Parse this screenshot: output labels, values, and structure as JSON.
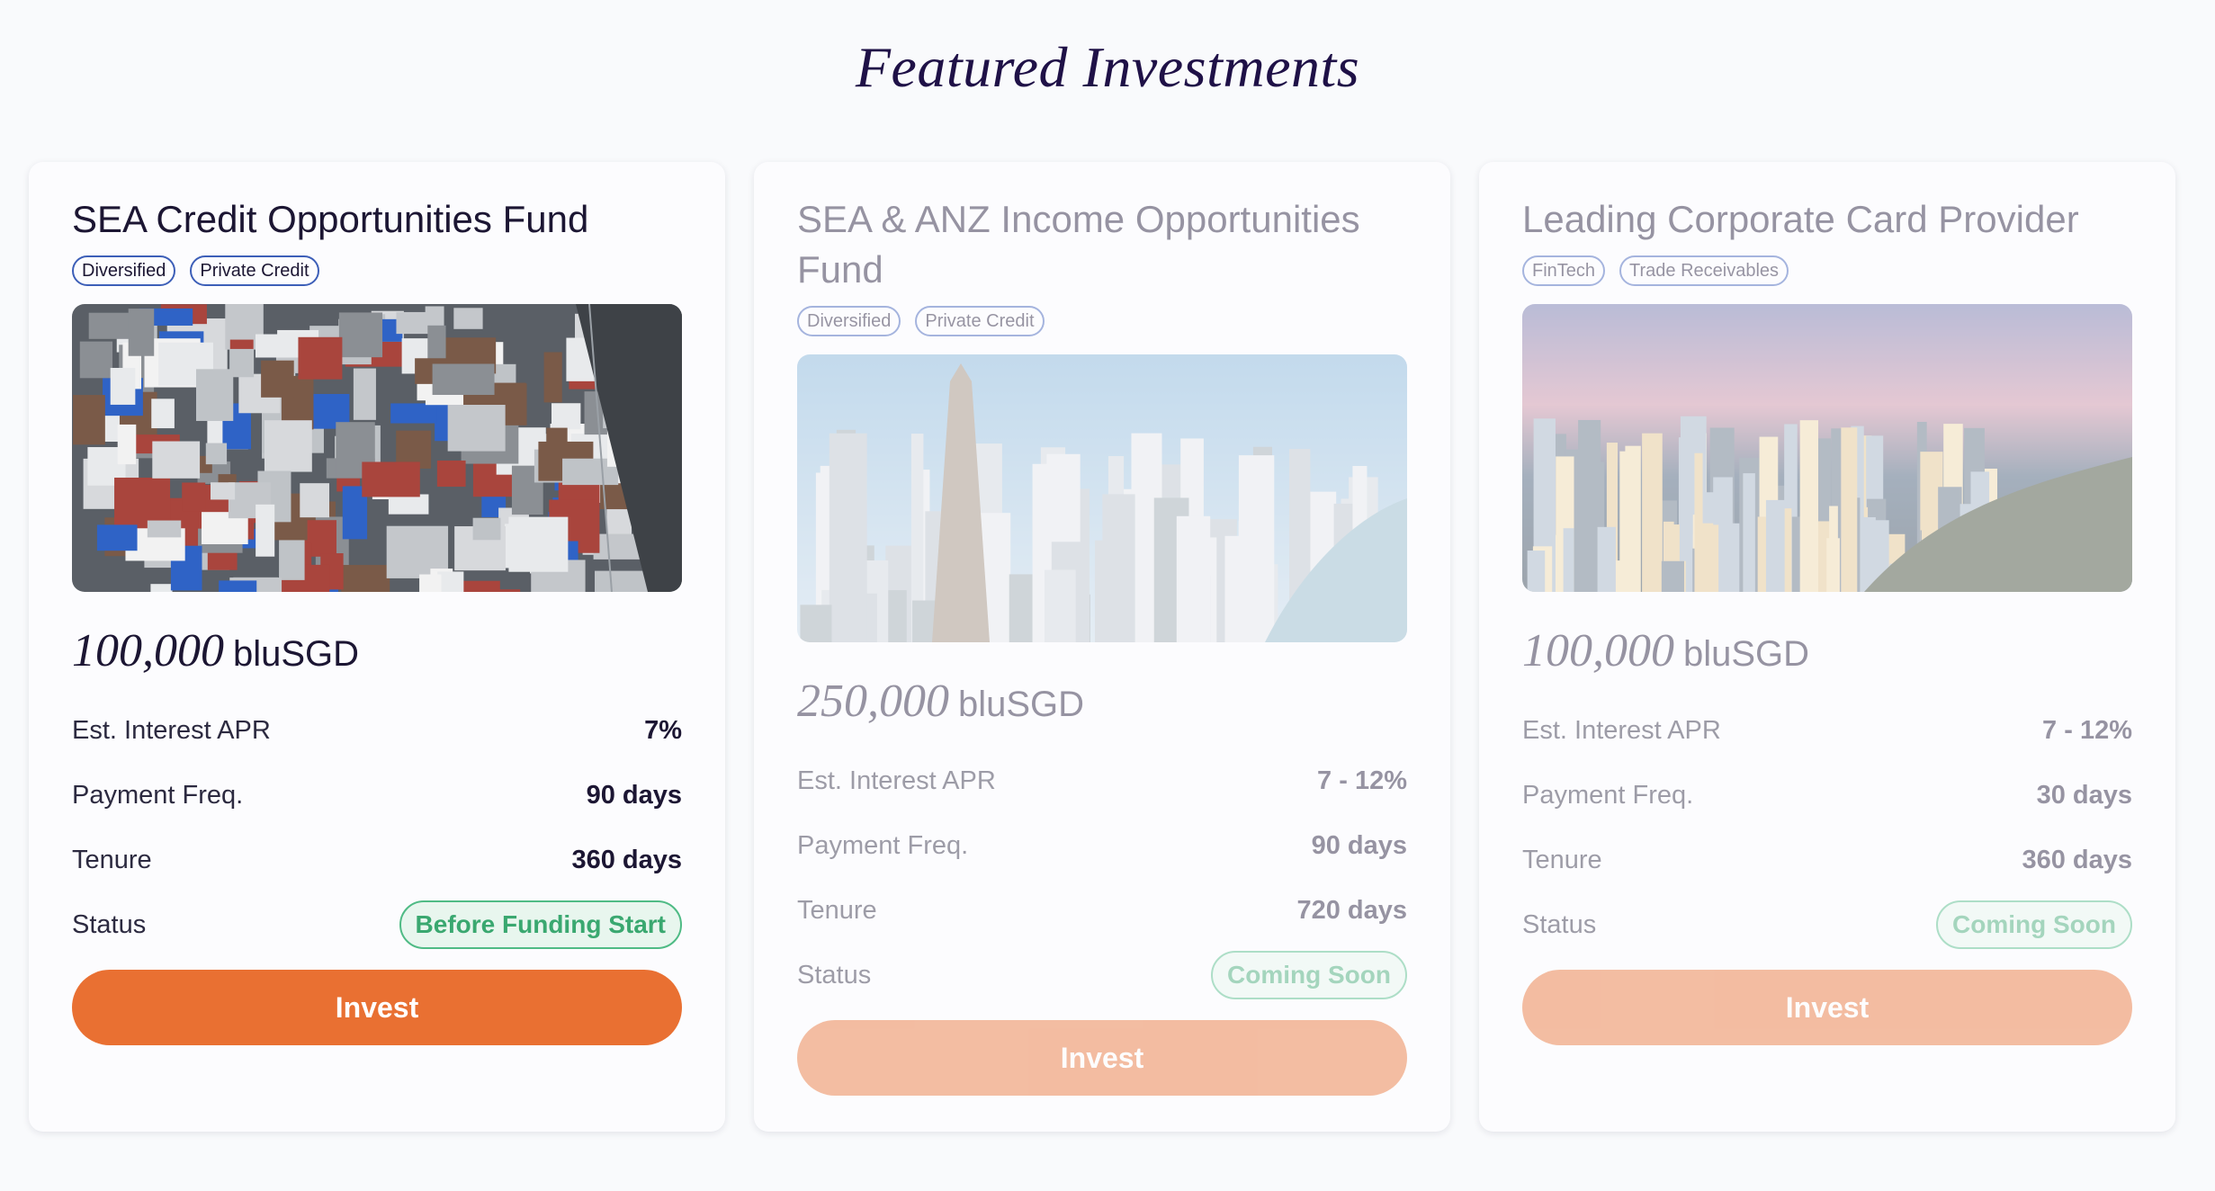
{
  "header": {
    "title": "Featured Investments"
  },
  "labels": {
    "apr": "Est. Interest APR",
    "freq": "Payment Freq.",
    "tenure": "Tenure",
    "status": "Status",
    "invest": "Invest"
  },
  "cards": [
    {
      "title": "SEA Credit Opportunities Fund",
      "tags": [
        "Diversified",
        "Private Credit"
      ],
      "image": "aerial-rooftops-photo",
      "amount": "100,000",
      "currency": "bluSGD",
      "apr": "7%",
      "freq": "90 days",
      "tenure": "360 days",
      "status": "Before Funding Start",
      "enabled": true
    },
    {
      "title": "SEA & ANZ Income Opportunities Fund",
      "tags": [
        "Diversified",
        "Private Credit"
      ],
      "image": "city-skyline-river-photo",
      "amount": "250,000",
      "currency": "bluSGD",
      "apr": "7 - 12%",
      "freq": "90 days",
      "tenure": "720 days",
      "status": "Coming Soon",
      "enabled": false
    },
    {
      "title": "Leading Corporate Card Provider",
      "tags": [
        "FinTech",
        "Trade Receivables"
      ],
      "image": "harbour-city-dusk-photo",
      "amount": "100,000",
      "currency": "bluSGD",
      "apr": "7 - 12%",
      "freq": "30 days",
      "tenure": "360 days",
      "status": "Coming Soon",
      "enabled": false
    }
  ],
  "colors": {
    "accent": "#e97032",
    "status_green": "#3aa870",
    "title": "#1f1147"
  }
}
